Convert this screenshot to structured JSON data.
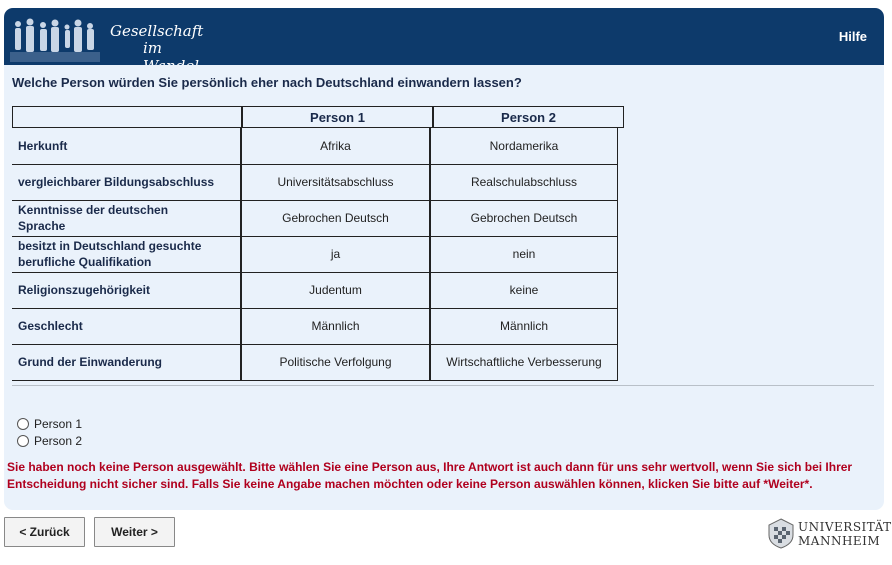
{
  "header": {
    "logo_line1": "Gesellschaft",
    "logo_line2": "im Wandel",
    "help_label": "Hilfe",
    "brand_color": "#0d3a6b"
  },
  "question": "Welche Person würden Sie persönlich eher nach Deutschland einwandern lassen?",
  "table": {
    "columns": [
      "Person 1",
      "Person 2"
    ],
    "rows": [
      {
        "label": "Herkunft",
        "p1": "Afrika",
        "p2": "Nordamerika"
      },
      {
        "label": "vergleichbarer Bildungsabschluss",
        "p1": "Universitätsabschluss",
        "p2": "Realschulabschluss"
      },
      {
        "label": "Kenntnisse der deutschen Sprache",
        "p1": "Gebrochen Deutsch",
        "p2": "Gebrochen Deutsch"
      },
      {
        "label": "besitzt in Deutschland gesuchte berufliche Qualifikation",
        "p1": "ja",
        "p2": "nein"
      },
      {
        "label": "Religionszugehörigkeit",
        "p1": "Judentum",
        "p2": "keine"
      },
      {
        "label": "Geschlecht",
        "p1": "Männlich",
        "p2": "Männlich"
      },
      {
        "label": "Grund der Einwanderung",
        "p1": "Politische Verfolgung",
        "p2": "Wirtschaftliche Verbesserung"
      }
    ]
  },
  "options": [
    "Person 1",
    "Person 2"
  ],
  "warning": "Sie haben noch keine Person ausgewählt. Bitte wählen Sie eine Person aus, Ihre Antwort ist auch dann für uns sehr wertvoll, wenn Sie sich bei Ihrer Entscheidung nicht sicher sind. Falls Sie keine Angabe machen möchten oder keine Person auswählen können, klicken Sie bitte auf *Weiter*.",
  "buttons": {
    "back": "< Zurück",
    "next": "Weiter >"
  },
  "university": {
    "line1": "UNIVERSITÄT",
    "line2": "MANNHEIM"
  }
}
